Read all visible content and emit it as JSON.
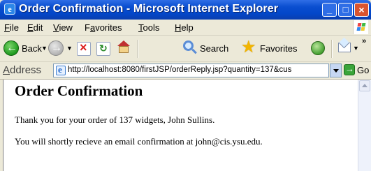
{
  "window": {
    "title": "Order Confirmation - Microsoft Internet Explorer",
    "controls": {
      "minimize": "_",
      "maximize": "□",
      "close": "×"
    }
  },
  "menu": {
    "items": [
      {
        "pre": "",
        "acc": "F",
        "post": "ile"
      },
      {
        "pre": "",
        "acc": "E",
        "post": "dit"
      },
      {
        "pre": "",
        "acc": "V",
        "post": "iew"
      },
      {
        "pre": "F",
        "acc": "a",
        "post": "vorites"
      },
      {
        "pre": "",
        "acc": "T",
        "post": "ools"
      },
      {
        "pre": "",
        "acc": "H",
        "post": "elp"
      }
    ]
  },
  "toolbar": {
    "back_label": "Back",
    "search_label": "Search",
    "favorites_label": "Favorites",
    "more_chevron": "»",
    "icons": [
      "back-icon",
      "forward-icon",
      "stop-icon",
      "refresh-icon",
      "home-icon",
      "search-icon",
      "favorites-star-icon",
      "media-icon",
      "mail-icon"
    ]
  },
  "address": {
    "label_acc": "A",
    "label_rest": "ddress",
    "url": "http://localhost:8080/firstJSP/orderReply.jsp?quantity=137&cus",
    "go_label": "Go"
  },
  "page": {
    "heading": "Order Confirmation",
    "line1": "Thank you for your order of 137 widgets, John Sullins.",
    "line2": "You will shortly recieve an email confirmation at john@cis.ysu.edu."
  }
}
